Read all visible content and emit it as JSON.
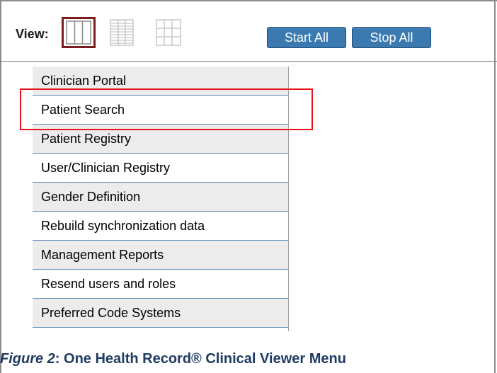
{
  "toolbar": {
    "view_label": "View:",
    "view_options": [
      "single-column-view-icon",
      "multi-row-view-icon",
      "grid-view-icon"
    ],
    "start_all_label": "Start All",
    "stop_all_label": "Stop All",
    "colors": {
      "button_bg": "#3a7ab0",
      "selected_border": "#7a1d1d"
    }
  },
  "menu": {
    "items": [
      {
        "label": "Clinician Portal"
      },
      {
        "label": "Patient Search"
      },
      {
        "label": "Patient Registry"
      },
      {
        "label": "User/Clinician Registry"
      },
      {
        "label": "Gender Definition"
      },
      {
        "label": "Rebuild synchronization data"
      },
      {
        "label": "Management Reports"
      },
      {
        "label": "Resend users and roles"
      },
      {
        "label": "Preferred Code Systems"
      }
    ],
    "highlighted_item": "Patient Search",
    "colors": {
      "highlight": "#e8121b",
      "row_alt": "#ececec",
      "divider": "#5b8ab5"
    }
  },
  "caption": {
    "figure_label": "Figure 2",
    "text": ": One Health Record® Clinical Viewer Menu"
  }
}
